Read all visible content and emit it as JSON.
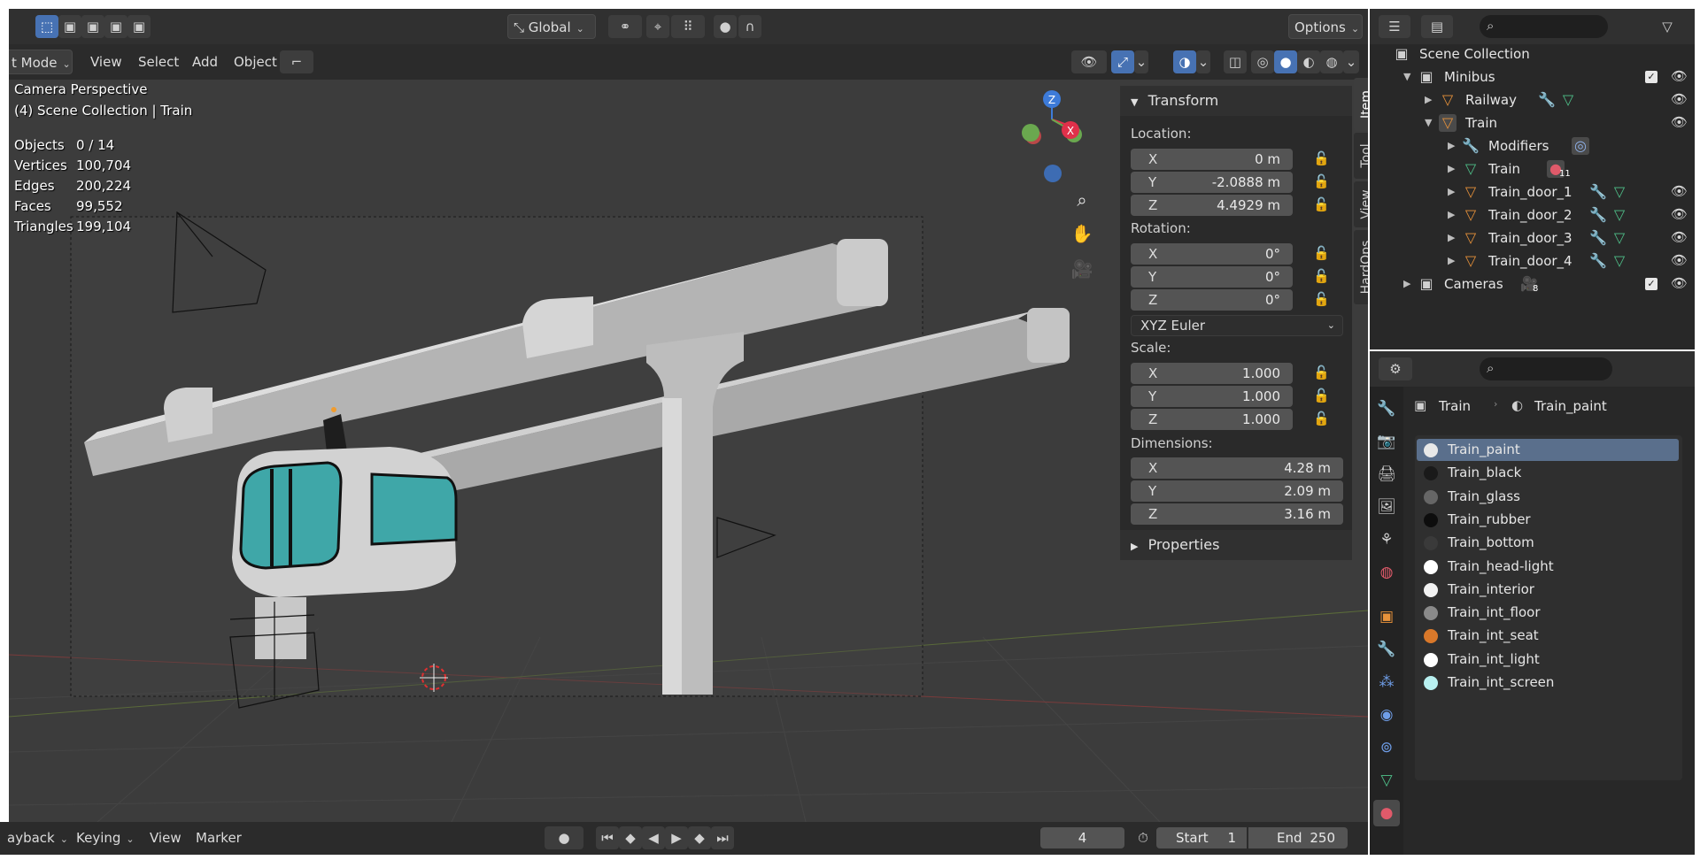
{
  "viewport": {
    "header": {
      "mode": "t Mode",
      "menus": [
        "View",
        "Select",
        "Add",
        "Object"
      ],
      "orientation": "Global",
      "options": "Options"
    },
    "overlay": {
      "perspective": "Camera Perspective",
      "collection": "(4) Scene Collection | Train"
    },
    "stats": [
      {
        "label": "Objects",
        "value": "0 / 14"
      },
      {
        "label": "Vertices",
        "value": "100,704"
      },
      {
        "label": "Edges",
        "value": "200,224"
      },
      {
        "label": "Faces",
        "value": "99,552"
      },
      {
        "label": "Triangles",
        "value": "199,104"
      }
    ],
    "gizmo": {
      "z": "Z",
      "x": "X"
    },
    "colors": {
      "background": "#3c3c3c",
      "rail": "#cfcfcf",
      "glass": "#3fa7a8",
      "x_axis": "#e0304a",
      "y_axis": "#6aa84f",
      "z_axis": "#3d7bd9"
    }
  },
  "npanel": {
    "transform_title": "Transform",
    "location_label": "Location:",
    "location": [
      {
        "axis": "X",
        "value": "0 m"
      },
      {
        "axis": "Y",
        "value": "-2.0888 m"
      },
      {
        "axis": "Z",
        "value": "4.4929 m"
      }
    ],
    "rotation_label": "Rotation:",
    "rotation": [
      {
        "axis": "X",
        "value": "0°"
      },
      {
        "axis": "Y",
        "value": "0°"
      },
      {
        "axis": "Z",
        "value": "0°"
      }
    ],
    "rotation_mode": "XYZ Euler",
    "scale_label": "Scale:",
    "scale": [
      {
        "axis": "X",
        "value": "1.000"
      },
      {
        "axis": "Y",
        "value": "1.000"
      },
      {
        "axis": "Z",
        "value": "1.000"
      }
    ],
    "dimensions_label": "Dimensions:",
    "dimensions": [
      {
        "axis": "X",
        "value": "4.28 m"
      },
      {
        "axis": "Y",
        "value": "2.09 m"
      },
      {
        "axis": "Z",
        "value": "3.16 m"
      }
    ],
    "properties_title": "Properties",
    "tabs": [
      "Item",
      "Tool",
      "View",
      "HardOps"
    ]
  },
  "timeline": {
    "playback": "ayback",
    "keying": "Keying",
    "view": "View",
    "marker": "Marker",
    "current_frame": "4",
    "start_label": "Start",
    "start": "1",
    "end_label": "End",
    "end": "250"
  },
  "outliner": {
    "rows": [
      {
        "label": "Scene Collection",
        "type": "scene"
      },
      {
        "label": "Minibus",
        "type": "collection"
      },
      {
        "label": "Railway",
        "type": "object"
      },
      {
        "label": "Train",
        "type": "object"
      },
      {
        "label": "Modifiers",
        "type": "modifiers"
      },
      {
        "label": "Train",
        "type": "mesh",
        "badge": "11"
      },
      {
        "label": "Train_door_1",
        "type": "object"
      },
      {
        "label": "Train_door_2",
        "type": "object"
      },
      {
        "label": "Train_door_3",
        "type": "object"
      },
      {
        "label": "Train_door_4",
        "type": "object"
      },
      {
        "label": "Cameras",
        "type": "collection",
        "badge": "8"
      }
    ]
  },
  "properties": {
    "breadcrumb_object": "Train",
    "breadcrumb_material": "Train_paint",
    "materials": [
      {
        "name": "Train_paint",
        "color": "#e8e8e8"
      },
      {
        "name": "Train_black",
        "color": "#1a1a1a"
      },
      {
        "name": "Train_glass",
        "color": "#666666"
      },
      {
        "name": "Train_rubber",
        "color": "#0d0d0d"
      },
      {
        "name": "Train_bottom",
        "color": "#3a3a3a"
      },
      {
        "name": "Train_head-light",
        "color": "#ffffff"
      },
      {
        "name": "Train_interior",
        "color": "#f2f2f2"
      },
      {
        "name": "Train_int_floor",
        "color": "#8a8a8a"
      },
      {
        "name": "Train_int_seat",
        "color": "#d9782a"
      },
      {
        "name": "Train_int_light",
        "color": "#ffffff"
      },
      {
        "name": "Train_int_screen",
        "color": "#b8f0f0"
      }
    ]
  }
}
